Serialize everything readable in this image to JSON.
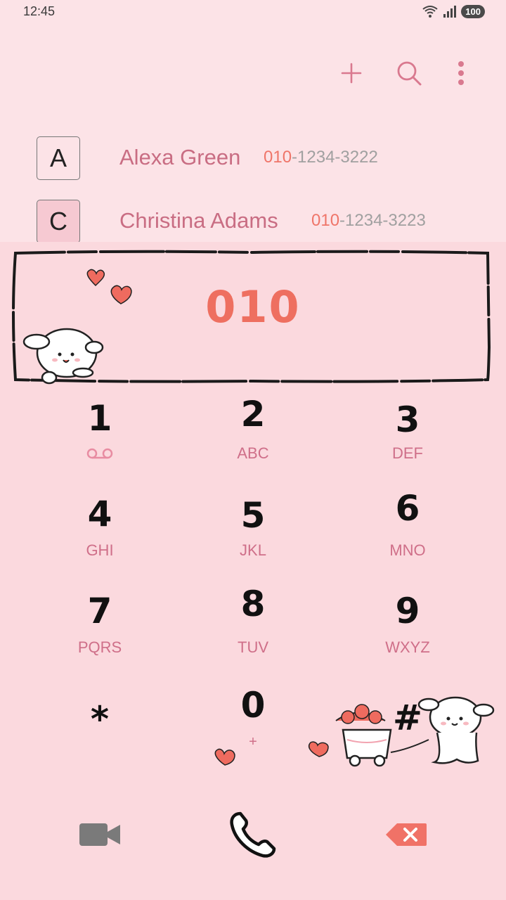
{
  "status_bar": {
    "time": "12:45",
    "battery": "100"
  },
  "toolbar": {
    "add_icon": "plus-icon",
    "search_icon": "search-icon",
    "menu_icon": "more-vert-icon"
  },
  "contacts": [
    {
      "letter": "A",
      "name": "Alexa Green",
      "number_match": "010",
      "number_rest": "-1234-3222"
    },
    {
      "letter": "C",
      "name": "Christina Adams",
      "number_match": "010",
      "number_rest": "-1234-3223"
    }
  ],
  "dialer": {
    "input": "010",
    "keys": [
      {
        "digit": "1",
        "letters": ""
      },
      {
        "digit": "2",
        "letters": "ABC"
      },
      {
        "digit": "3",
        "letters": "DEF"
      },
      {
        "digit": "4",
        "letters": "GHI"
      },
      {
        "digit": "5",
        "letters": "JKL"
      },
      {
        "digit": "6",
        "letters": "MNO"
      },
      {
        "digit": "7",
        "letters": "PQRS"
      },
      {
        "digit": "8",
        "letters": "TUV"
      },
      {
        "digit": "9",
        "letters": "WXYZ"
      },
      {
        "digit": "*",
        "letters": ""
      },
      {
        "digit": "0",
        "letters": "+"
      },
      {
        "digit": "#",
        "letters": ""
      }
    ]
  },
  "colors": {
    "accent": "#ee6f60",
    "name": "#c96d83",
    "letters": "#cf6f89",
    "background": "#fbd9de"
  }
}
